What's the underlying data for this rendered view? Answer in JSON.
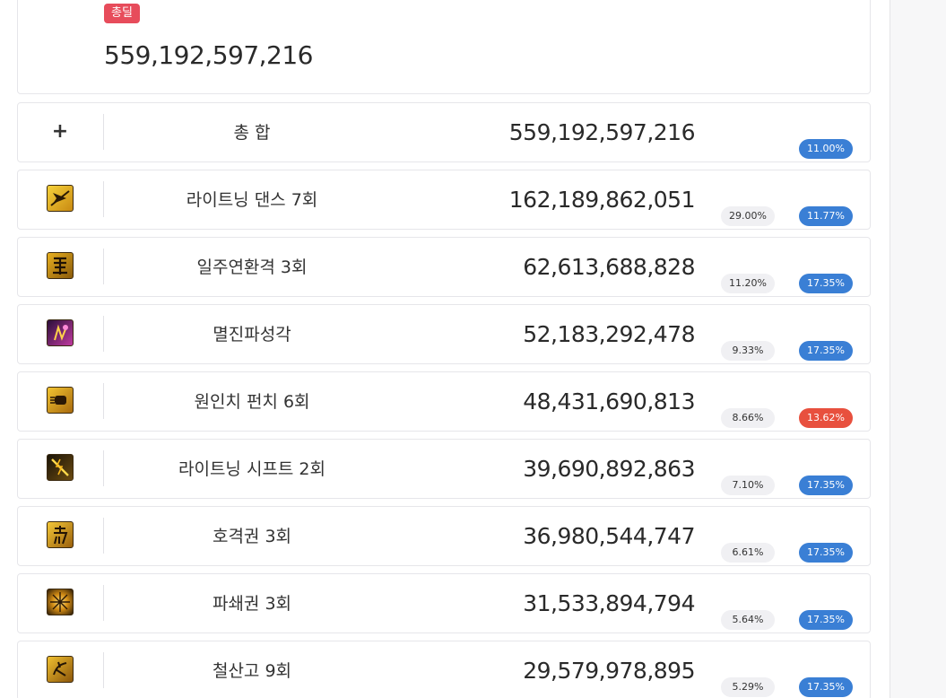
{
  "summary": {
    "badge": "총딜",
    "total": "559,192,597,216"
  },
  "total_row": {
    "icon": "plus-icon",
    "icon_glyph": "+",
    "name": "총 합",
    "damage": "559,192,597,216",
    "rate": "11.00%"
  },
  "skills": [
    {
      "icon": "lightning-dance-icon",
      "name": "라이트닝 댄스 7회",
      "damage": "162,189,862,051",
      "share": "29.00%",
      "rate": "11.77%",
      "rate_color": "blue"
    },
    {
      "icon": "chain-strike-icon",
      "name": "일주연환격 3회",
      "damage": "62,613,688,828",
      "share": "11.20%",
      "rate": "17.35%",
      "rate_color": "blue"
    },
    {
      "icon": "annihilation-icon",
      "name": "멸진파성각",
      "damage": "52,183,292,478",
      "share": "9.33%",
      "rate": "17.35%",
      "rate_color": "blue"
    },
    {
      "icon": "one-inch-punch-icon",
      "name": "원인치 펀치 6회",
      "damage": "48,431,690,813",
      "share": "8.66%",
      "rate": "13.62%",
      "rate_color": "red"
    },
    {
      "icon": "lightning-shift-icon",
      "name": "라이트닝 시프트 2회",
      "damage": "39,690,892,863",
      "share": "7.10%",
      "rate": "17.35%",
      "rate_color": "blue"
    },
    {
      "icon": "tiger-fist-icon",
      "name": "호격권 3회",
      "damage": "36,980,544,747",
      "share": "6.61%",
      "rate": "17.35%",
      "rate_color": "blue"
    },
    {
      "icon": "shatter-fist-icon",
      "name": "파쇄권 3회",
      "damage": "31,533,894,794",
      "share": "5.64%",
      "rate": "17.35%",
      "rate_color": "blue"
    },
    {
      "icon": "iron-mountain-icon",
      "name": "철산고 9회",
      "damage": "29,579,978,895",
      "share": "5.29%",
      "rate": "17.35%",
      "rate_color": "blue"
    }
  ],
  "colors": {
    "badge": "#e74c5b",
    "rate_blue": "#3a7fd5",
    "rate_red": "#e8503e",
    "share_pill": "#f0f0f3"
  }
}
